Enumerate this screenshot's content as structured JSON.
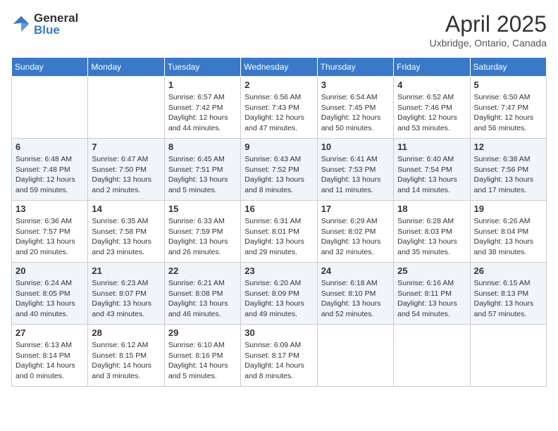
{
  "header": {
    "logo_line1": "General",
    "logo_line2": "Blue",
    "month": "April 2025",
    "location": "Uxbridge, Ontario, Canada"
  },
  "weekdays": [
    "Sunday",
    "Monday",
    "Tuesday",
    "Wednesday",
    "Thursday",
    "Friday",
    "Saturday"
  ],
  "weeks": [
    [
      {
        "day": "",
        "info": ""
      },
      {
        "day": "",
        "info": ""
      },
      {
        "day": "1",
        "info": "Sunrise: 6:57 AM\nSunset: 7:42 PM\nDaylight: 12 hours\nand 44 minutes."
      },
      {
        "day": "2",
        "info": "Sunrise: 6:56 AM\nSunset: 7:43 PM\nDaylight: 12 hours\nand 47 minutes."
      },
      {
        "day": "3",
        "info": "Sunrise: 6:54 AM\nSunset: 7:45 PM\nDaylight: 12 hours\nand 50 minutes."
      },
      {
        "day": "4",
        "info": "Sunrise: 6:52 AM\nSunset: 7:46 PM\nDaylight: 12 hours\nand 53 minutes."
      },
      {
        "day": "5",
        "info": "Sunrise: 6:50 AM\nSunset: 7:47 PM\nDaylight: 12 hours\nand 56 minutes."
      }
    ],
    [
      {
        "day": "6",
        "info": "Sunrise: 6:48 AM\nSunset: 7:48 PM\nDaylight: 12 hours\nand 59 minutes."
      },
      {
        "day": "7",
        "info": "Sunrise: 6:47 AM\nSunset: 7:50 PM\nDaylight: 13 hours\nand 2 minutes."
      },
      {
        "day": "8",
        "info": "Sunrise: 6:45 AM\nSunset: 7:51 PM\nDaylight: 13 hours\nand 5 minutes."
      },
      {
        "day": "9",
        "info": "Sunrise: 6:43 AM\nSunset: 7:52 PM\nDaylight: 13 hours\nand 8 minutes."
      },
      {
        "day": "10",
        "info": "Sunrise: 6:41 AM\nSunset: 7:53 PM\nDaylight: 13 hours\nand 11 minutes."
      },
      {
        "day": "11",
        "info": "Sunrise: 6:40 AM\nSunset: 7:54 PM\nDaylight: 13 hours\nand 14 minutes."
      },
      {
        "day": "12",
        "info": "Sunrise: 6:38 AM\nSunset: 7:56 PM\nDaylight: 13 hours\nand 17 minutes."
      }
    ],
    [
      {
        "day": "13",
        "info": "Sunrise: 6:36 AM\nSunset: 7:57 PM\nDaylight: 13 hours\nand 20 minutes."
      },
      {
        "day": "14",
        "info": "Sunrise: 6:35 AM\nSunset: 7:58 PM\nDaylight: 13 hours\nand 23 minutes."
      },
      {
        "day": "15",
        "info": "Sunrise: 6:33 AM\nSunset: 7:59 PM\nDaylight: 13 hours\nand 26 minutes."
      },
      {
        "day": "16",
        "info": "Sunrise: 6:31 AM\nSunset: 8:01 PM\nDaylight: 13 hours\nand 29 minutes."
      },
      {
        "day": "17",
        "info": "Sunrise: 6:29 AM\nSunset: 8:02 PM\nDaylight: 13 hours\nand 32 minutes."
      },
      {
        "day": "18",
        "info": "Sunrise: 6:28 AM\nSunset: 8:03 PM\nDaylight: 13 hours\nand 35 minutes."
      },
      {
        "day": "19",
        "info": "Sunrise: 6:26 AM\nSunset: 8:04 PM\nDaylight: 13 hours\nand 38 minutes."
      }
    ],
    [
      {
        "day": "20",
        "info": "Sunrise: 6:24 AM\nSunset: 8:05 PM\nDaylight: 13 hours\nand 40 minutes."
      },
      {
        "day": "21",
        "info": "Sunrise: 6:23 AM\nSunset: 8:07 PM\nDaylight: 13 hours\nand 43 minutes."
      },
      {
        "day": "22",
        "info": "Sunrise: 6:21 AM\nSunset: 8:08 PM\nDaylight: 13 hours\nand 46 minutes."
      },
      {
        "day": "23",
        "info": "Sunrise: 6:20 AM\nSunset: 8:09 PM\nDaylight: 13 hours\nand 49 minutes."
      },
      {
        "day": "24",
        "info": "Sunrise: 6:18 AM\nSunset: 8:10 PM\nDaylight: 13 hours\nand 52 minutes."
      },
      {
        "day": "25",
        "info": "Sunrise: 6:16 AM\nSunset: 8:11 PM\nDaylight: 13 hours\nand 54 minutes."
      },
      {
        "day": "26",
        "info": "Sunrise: 6:15 AM\nSunset: 8:13 PM\nDaylight: 13 hours\nand 57 minutes."
      }
    ],
    [
      {
        "day": "27",
        "info": "Sunrise: 6:13 AM\nSunset: 8:14 PM\nDaylight: 14 hours\nand 0 minutes."
      },
      {
        "day": "28",
        "info": "Sunrise: 6:12 AM\nSunset: 8:15 PM\nDaylight: 14 hours\nand 3 minutes."
      },
      {
        "day": "29",
        "info": "Sunrise: 6:10 AM\nSunset: 8:16 PM\nDaylight: 14 hours\nand 5 minutes."
      },
      {
        "day": "30",
        "info": "Sunrise: 6:09 AM\nSunset: 8:17 PM\nDaylight: 14 hours\nand 8 minutes."
      },
      {
        "day": "",
        "info": ""
      },
      {
        "day": "",
        "info": ""
      },
      {
        "day": "",
        "info": ""
      }
    ]
  ]
}
